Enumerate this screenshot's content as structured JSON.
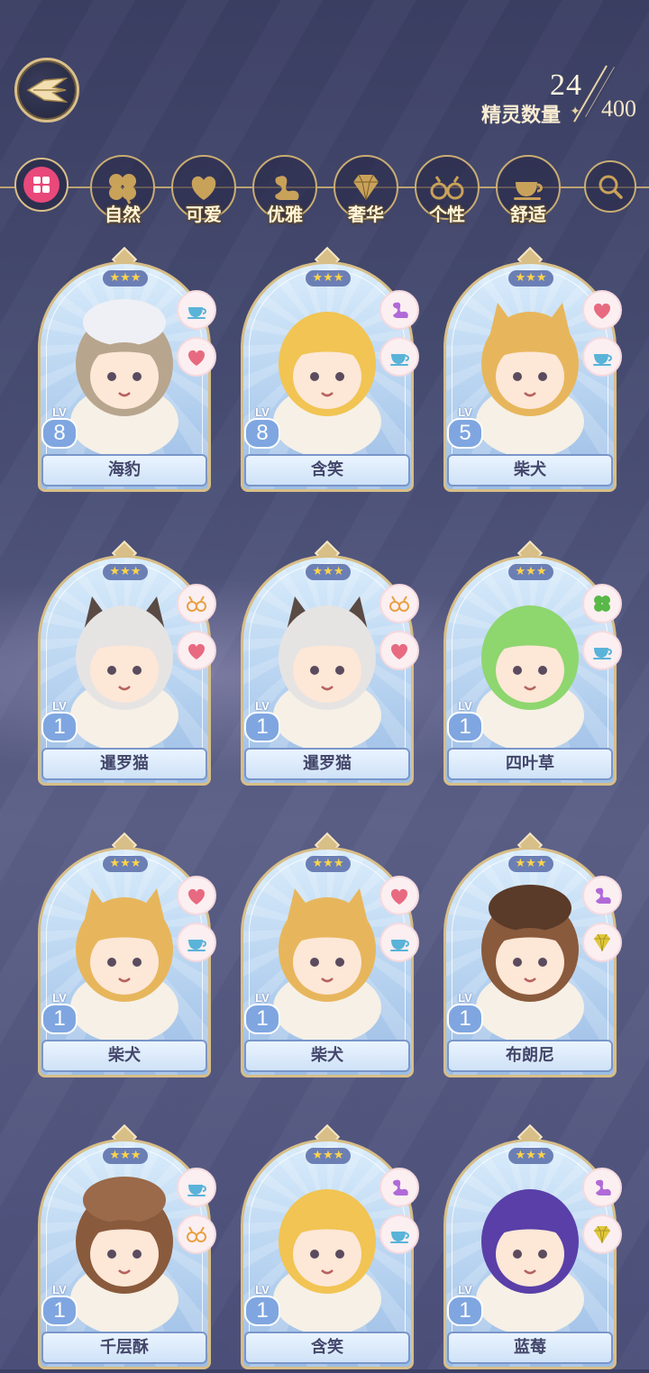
{
  "header": {
    "back_icon": "back-arrow-wings-icon",
    "counter": {
      "current": "24",
      "total": "400",
      "label": "精灵数量"
    }
  },
  "filters": {
    "all_icon": "grid-icon",
    "search_icon": "search-icon",
    "items": [
      {
        "label": "自然",
        "icon": "clover-icon"
      },
      {
        "label": "可爱",
        "icon": "heart-icon"
      },
      {
        "label": "优雅",
        "icon": "swan-icon"
      },
      {
        "label": "奢华",
        "icon": "diamond-icon"
      },
      {
        "label": "个性",
        "icon": "glasses-icon"
      },
      {
        "label": "舒适",
        "icon": "teacup-icon"
      }
    ]
  },
  "stars": "★★★",
  "lv_label": "LV",
  "cards": [
    {
      "name": "海豹",
      "level": "8",
      "traits": [
        "teacup-icon",
        "heart-icon"
      ]
    },
    {
      "name": "含笑",
      "level": "8",
      "traits": [
        "swan-icon",
        "teacup-icon"
      ]
    },
    {
      "name": "柴犬",
      "level": "5",
      "traits": [
        "heart-icon",
        "teacup-icon"
      ]
    },
    {
      "name": "暹罗猫",
      "level": "1",
      "traits": [
        "glasses-icon",
        "heart-icon"
      ]
    },
    {
      "name": "暹罗猫",
      "level": "1",
      "traits": [
        "glasses-icon",
        "heart-icon"
      ]
    },
    {
      "name": "四叶草",
      "level": "1",
      "traits": [
        "clover-icon",
        "teacup-icon"
      ]
    },
    {
      "name": "柴犬",
      "level": "1",
      "traits": [
        "heart-icon",
        "teacup-icon"
      ]
    },
    {
      "name": "柴犬",
      "level": "1",
      "traits": [
        "heart-icon",
        "teacup-icon"
      ]
    },
    {
      "name": "布朗尼",
      "level": "1",
      "traits": [
        "swan-icon",
        "diamond-icon"
      ]
    },
    {
      "name": "千层酥",
      "level": "1",
      "traits": [
        "teacup-icon",
        "glasses-icon"
      ]
    },
    {
      "name": "含笑",
      "level": "1",
      "traits": [
        "swan-icon",
        "teacup-icon"
      ]
    },
    {
      "name": "蓝莓",
      "level": "1",
      "traits": [
        "swan-icon",
        "diamond-icon"
      ]
    }
  ],
  "colors": {
    "accent_gold": "#d8be87",
    "heart": "#e86a80",
    "swan": "#b06ad8",
    "teacup": "#5ab3d8",
    "glasses": "#e8a040",
    "clover": "#58b848",
    "diamond": "#e0c83a",
    "all_button": "#e8497a"
  }
}
